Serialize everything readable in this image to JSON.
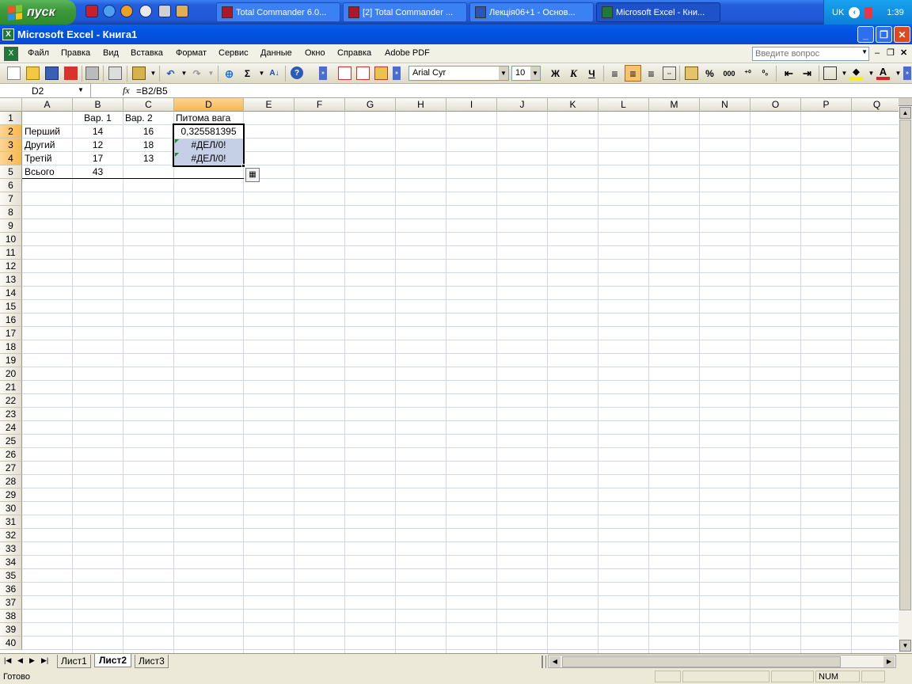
{
  "taskbar": {
    "start_label": "пуск",
    "tasks": [
      {
        "label": "Total Commander 6.0...",
        "active": false
      },
      {
        "label": "[2] Total Commander ...",
        "active": false
      },
      {
        "label": "Лекція06+1 - Основ...",
        "active": false
      },
      {
        "label": "Microsoft Excel - Кни...",
        "active": true
      }
    ],
    "lang": "UK",
    "clock": "1:39"
  },
  "window": {
    "title": "Microsoft Excel - Книга1"
  },
  "menu": {
    "items": [
      "Файл",
      "Правка",
      "Вид",
      "Вставка",
      "Формат",
      "Сервис",
      "Данные",
      "Окно",
      "Справка",
      "Adobe PDF"
    ],
    "help_placeholder": "Введите вопрос"
  },
  "toolbar": {
    "font_name": "Arial Cyr",
    "font_size": "10",
    "bold": "Ж",
    "italic": "К",
    "underline": "Ч",
    "percent": "%",
    "thousands": "000",
    "sigma": "Σ"
  },
  "formula_bar": {
    "name_box": "D2",
    "fx": "fx",
    "formula": "=B2/B5"
  },
  "sheet": {
    "columns": [
      "A",
      "B",
      "C",
      "D",
      "E",
      "F",
      "G",
      "H",
      "I",
      "J",
      "K",
      "L",
      "M",
      "N",
      "O",
      "P",
      "Q"
    ],
    "selected_column": "D",
    "row_count": 40,
    "selected_rows": [
      2,
      3,
      4
    ],
    "cells": {
      "B1": "Вар. 1",
      "C1": "Вар. 2",
      "D1": "Питома вага",
      "A2": "Перший",
      "B2": "14",
      "C2": "16",
      "D2": "0,325581395",
      "A3": "Другий",
      "B3": "12",
      "C3": "18",
      "D3": "#ДЕЛ/0!",
      "A4": "Третій",
      "B4": "17",
      "C4": "13",
      "D4": "#ДЕЛ/0!",
      "A5": "Всього",
      "B5": "43"
    },
    "tabs": [
      "Лист1",
      "Лист2",
      "Лист3"
    ],
    "active_tab": "Лист2"
  },
  "status": {
    "ready": "Готово",
    "num": "NUM"
  },
  "colors": {
    "selection": "#c5d0e6",
    "selected_header": "#f8b74e",
    "xp_blue": "#0053e1"
  }
}
